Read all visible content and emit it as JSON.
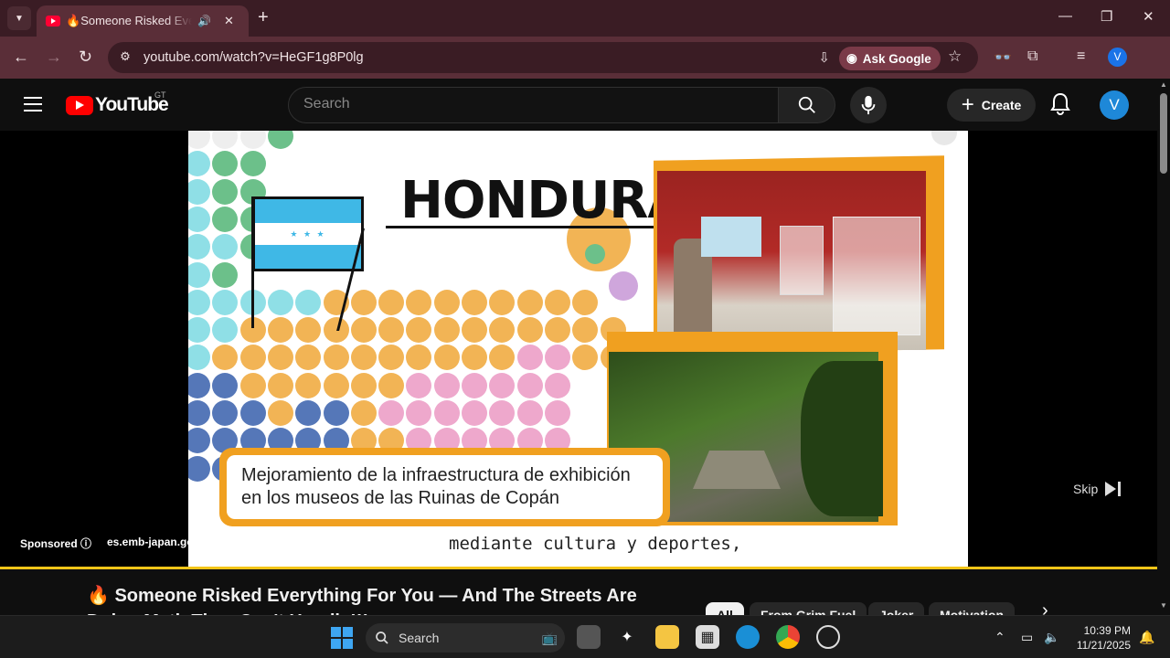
{
  "browser": {
    "tab_title": "Someone Risked Everything For You",
    "tab_title_prefix": "🔥",
    "url": "youtube.com/watch?v=HeGF1g8P0lg",
    "ask_google": "Ask Google",
    "profile_initial": "V"
  },
  "youtube": {
    "logo_text": "YouTube",
    "country_code": "GT",
    "search_placeholder": "Search",
    "create_label": "Create",
    "avatar_initial": "V"
  },
  "ad": {
    "country_heading": "HONDURAS",
    "caption_line1": "Mejoramiento de la infraestructura de exhibición",
    "caption_line2": "en los museos de las Ruinas de Copán",
    "subtitle": "mediante cultura y deportes,",
    "sponsored_label": "Sponsored",
    "advertiser_url": "es.emb-japan.go.jp",
    "skip_label": "Skip",
    "progress_fraction": 1.0,
    "accent_color": "#f0a020"
  },
  "video": {
    "title": "🔥 Someone Risked Everything For You — And The Streets Are Doing Math They Can't Handle!!!",
    "chips": [
      "All",
      "From Grim Fuel",
      "Joker",
      "Motivation"
    ]
  },
  "taskbar": {
    "search_label": "Search",
    "time": "10:39 PM",
    "date": "11/21/2025"
  }
}
